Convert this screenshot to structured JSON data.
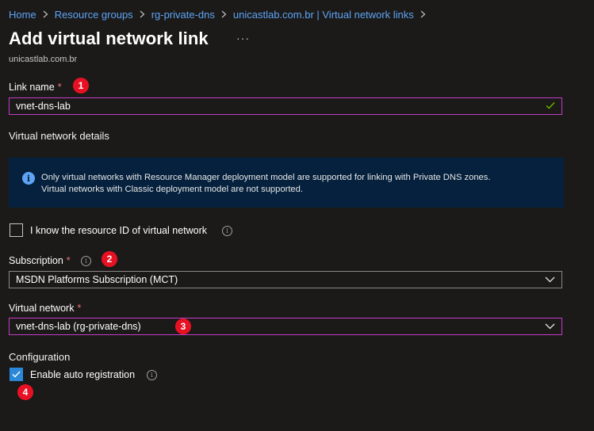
{
  "breadcrumb": {
    "items": [
      "Home",
      "Resource groups",
      "rg-private-dns",
      "unicastlab.com.br | Virtual network links"
    ]
  },
  "header": {
    "title": "Add virtual network link",
    "more_label": "···",
    "subtitle": "unicastlab.com.br"
  },
  "link_name": {
    "label": "Link name",
    "required_mark": "*",
    "value": "vnet-dns-lab",
    "badge": "1"
  },
  "vnet_details": {
    "heading": "Virtual network details",
    "info_icon_glyph": "i",
    "info_line1": "Only virtual networks with Resource Manager deployment model are supported for linking with Private DNS zones.",
    "info_line2": "Virtual networks with Classic deployment model are not supported."
  },
  "resource_id": {
    "label": "I know the resource ID of virtual network",
    "checked": false
  },
  "subscription": {
    "label": "Subscription",
    "required_mark": "*",
    "value": "MSDN Platforms Subscription (MCT)",
    "badge": "2"
  },
  "virtual_network": {
    "label": "Virtual network",
    "required_mark": "*",
    "value": "vnet-dns-lab (rg-private-dns)",
    "badge": "3"
  },
  "configuration": {
    "heading": "Configuration",
    "auto_registration_label": "Enable auto registration",
    "auto_registration_checked": true,
    "badge": "4"
  },
  "tooltip_glyph": "i",
  "colors": {
    "background": "#1b1a19",
    "link": "#5ea4f4",
    "focus_border": "#c53cc5",
    "badge": "#e81123",
    "info_background": "#05213d",
    "checkbox_checked": "#2b88d8",
    "valid_check": "#6bb700"
  },
  "icons": {
    "breadcrumb_separator": "chevron-right-icon",
    "valid": "checkmark-icon",
    "dropdown": "chevron-down-icon",
    "info": "info-icon",
    "tooltip": "info-tooltip-icon"
  }
}
